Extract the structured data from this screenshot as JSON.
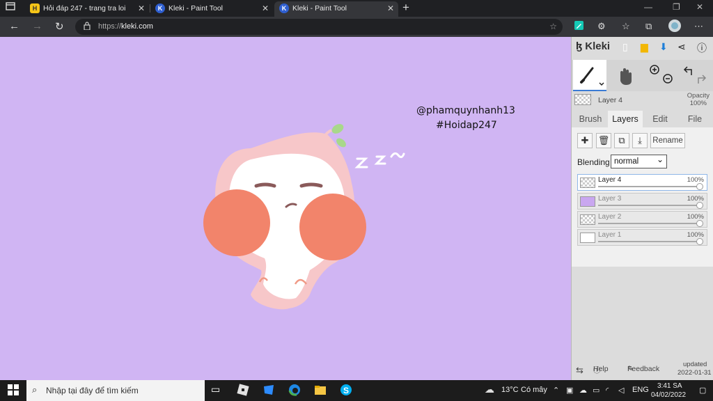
{
  "browser": {
    "tabs": [
      {
        "title": "Hỏi đáp 247 - trang tra loi",
        "favicon": "H"
      },
      {
        "title": "Kleki - Paint Tool",
        "favicon": "K"
      },
      {
        "title": "Kleki - Paint Tool",
        "favicon": "K"
      }
    ],
    "url_prefix": "https://",
    "url_domain": "kleki.com"
  },
  "canvas": {
    "background": "#d0b5f3",
    "watermark_line1": "@phamquynhanh13",
    "watermark_line2": "#Hoidap247",
    "zzz": "z z ~"
  },
  "panel": {
    "logo": "Kleki",
    "current_layer": "Layer 4",
    "opacity_label": "Opacity",
    "opacity_value": "100%",
    "tabs": [
      "Brush",
      "Layers",
      "Edit",
      "File"
    ],
    "rename": "Rename",
    "blending_label": "Blending",
    "blending_value": "normal",
    "layers": [
      {
        "name": "Layer 4",
        "opacity": "100%"
      },
      {
        "name": "Layer 3",
        "opacity": "100%"
      },
      {
        "name": "Layer 2",
        "opacity": "100%"
      },
      {
        "name": "Layer 1",
        "opacity": "100%"
      }
    ],
    "help": "Help",
    "feedback": "Feedback",
    "updated_label": "updated",
    "updated_date": "2022-01-31"
  },
  "taskbar": {
    "search_placeholder": "Nhập tại đây để tìm kiếm",
    "weather": "13°C",
    "weather_desc": "Có mây",
    "lang": "ENG",
    "time": "3:41 SA",
    "date": "04/02/2022"
  }
}
